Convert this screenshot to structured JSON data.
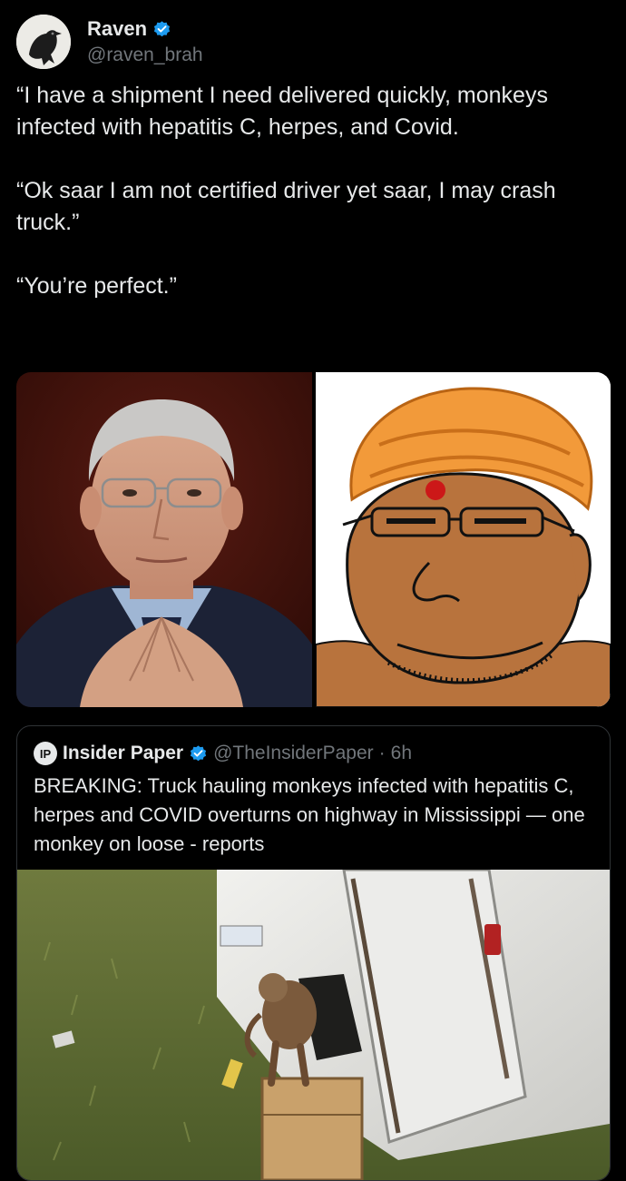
{
  "tweet": {
    "author": {
      "name": "Raven",
      "handle": "@raven_brah",
      "verified": true,
      "avatar_icon": "raven-avatar-icon"
    },
    "paragraphs": [
      "“I have a shipment I need delivered quickly, monkeys infected with hepatitis C, herpes, and Covid.",
      "“Ok saar I am not certified driver yet saar, I may crash truck.”",
      "“You’re perfect.”"
    ],
    "media": [
      {
        "kind": "photo",
        "icon": "man-photo"
      },
      {
        "kind": "cartoon",
        "icon": "turban-wojak-cartoon"
      }
    ]
  },
  "quote": {
    "avatar_text": "IP",
    "name": "Insider Paper",
    "verified": true,
    "handle": "@TheInsiderPaper",
    "separator": "·",
    "time": "6h",
    "text": "BREAKING: Truck hauling monkeys infected with hepatitis C, herpes and COVID overturns on highway in Mississippi — one monkey on loose - reports",
    "image": {
      "kind": "photo",
      "icon": "overturned-truck-monkey-photo"
    }
  },
  "colors": {
    "background": "#000000",
    "text": "#e7e9ea",
    "secondary": "#71767b",
    "verified": "#1d9bf0",
    "border": "#2f3336",
    "turban": "#f29a3a",
    "skin_cartoon": "#b8733d"
  }
}
